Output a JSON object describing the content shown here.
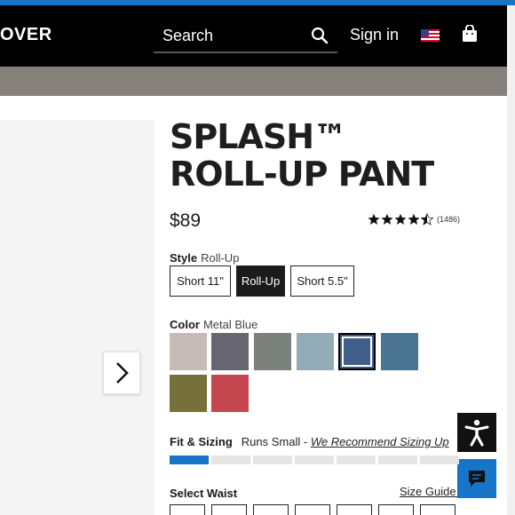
{
  "header": {
    "brand": "OVER",
    "search_label": "Search",
    "signin_label": "Sign in",
    "flag": "us-flag-icon",
    "bag": "shopping-bag-icon"
  },
  "product": {
    "title_line1": "SPLASH™",
    "title_line2": "ROLL-UP PANT",
    "price": "$89",
    "rating": 4.5,
    "review_count": "(1486)"
  },
  "style": {
    "label": "Style",
    "selected": "Roll-Up",
    "options": [
      "Short 11\"",
      "Roll-Up",
      "Short 5.5\""
    ]
  },
  "color": {
    "label": "Color",
    "selected": "Metal Blue",
    "swatches": [
      "#c6bbb6",
      "#676570",
      "#7b827d",
      "#93aab7",
      "#3f5e8a",
      "#4b7492",
      "#76713b",
      "#c4474f"
    ]
  },
  "fit": {
    "label": "Fit & Sizing",
    "runs": "Runs Small -",
    "recommend": "We Recommend Sizing Up",
    "segments_total": 7,
    "active_segment": 1
  },
  "waist": {
    "label": "Select Waist",
    "size_guide": "Size Guide +"
  },
  "colors": {
    "accent": "#1674c9",
    "header_bg": "#000000",
    "promo_bg": "#86807a"
  }
}
